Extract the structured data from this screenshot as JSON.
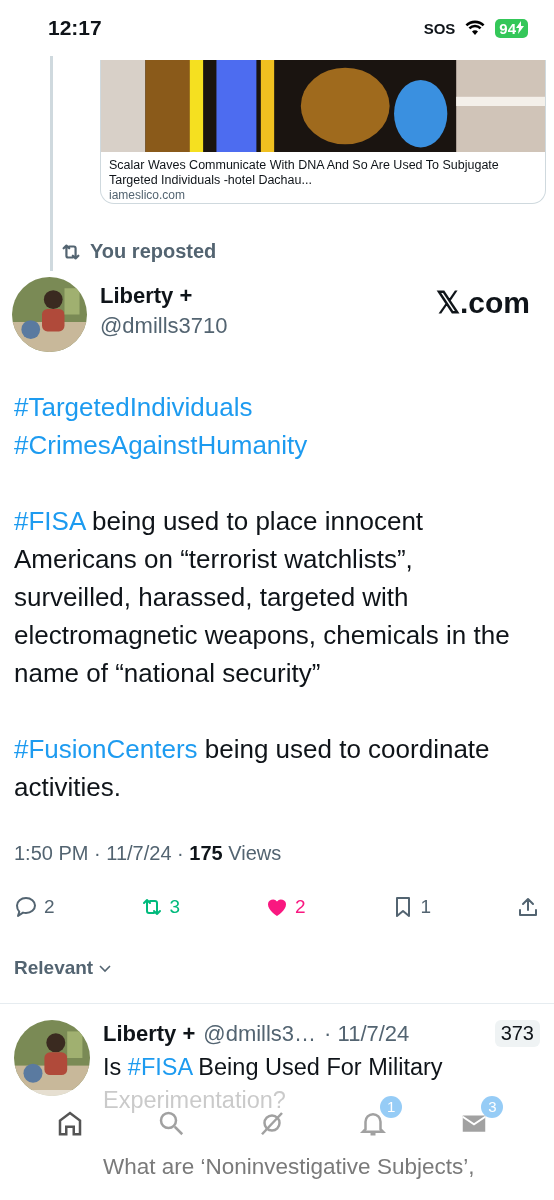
{
  "status_bar": {
    "time": "12:17",
    "sos": "SOS",
    "battery": "94"
  },
  "link_card": {
    "title": "Scalar Waves Communicate With DNA And So Are Used To Subjugate Targeted Individuals -hotel Dachau...",
    "domain": "iameslico.com"
  },
  "repost_note": "You reposted",
  "post": {
    "author": "Liberty +",
    "handle": "@dmills3710",
    "brand": "𝕏.com",
    "paragraphs": [
      [
        {
          "kind": "hashtag",
          "text": "#TargetedIndividuals"
        },
        {
          "kind": "break"
        },
        {
          "kind": "hashtag",
          "text": "#CrimesAgainstHumanity"
        }
      ],
      [
        {
          "kind": "hashtag",
          "text": "#FISA"
        },
        {
          "kind": "text",
          "text": " being used to place innocent Americans on “terrorist watchlists”, surveilled, harassed, targeted with electromagnetic weapons, chemicals in the name of “national security”"
        }
      ],
      [
        {
          "kind": "hashtag",
          "text": "#FusionCenters"
        },
        {
          "kind": "text",
          "text": " being used to coordinate activities."
        }
      ]
    ],
    "time": "1:50 PM · 11/7/24 · ",
    "views_count": "175",
    "views_label": "Views",
    "actions": [
      {
        "kind": "reply",
        "count": "2"
      },
      {
        "kind": "repost",
        "count": "3",
        "active": true
      },
      {
        "kind": "like",
        "count": "2",
        "active": true
      },
      {
        "kind": "bookmark",
        "count": "1"
      },
      {
        "kind": "share"
      }
    ]
  },
  "sort": {
    "label": "Relevant"
  },
  "reply": {
    "author": "Liberty +",
    "handle": "@dmills3…",
    "date": "· 11/7/24",
    "count": "373",
    "text": [
      {
        "kind": "text",
        "text": "Is "
      },
      {
        "kind": "hashtag",
        "text": "#FISA"
      },
      {
        "kind": "text",
        "text": " Being Used For Military"
      }
    ],
    "text_cont": "Experimentation?",
    "text2": "What are ‘Noninvestigative Subjects’,"
  },
  "tab_bar": [
    {
      "kind": "home",
      "selected": true
    },
    {
      "kind": "search",
      "selected": false
    },
    {
      "kind": "grok",
      "selected": false
    },
    {
      "kind": "bell",
      "selected": false,
      "badge": "1"
    },
    {
      "kind": "mail",
      "selected": false,
      "badge": "3"
    }
  ]
}
